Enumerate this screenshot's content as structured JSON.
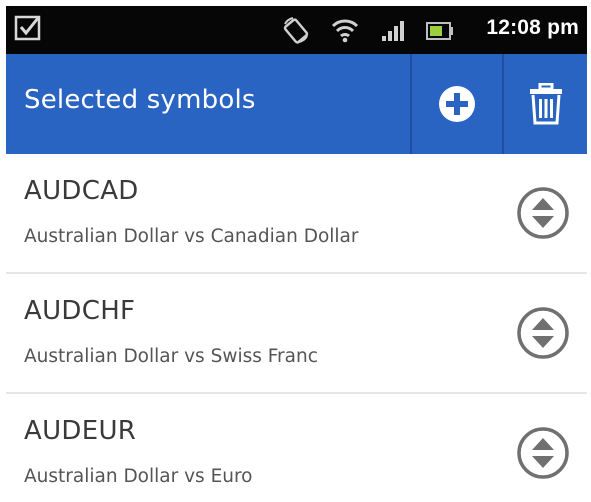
{
  "status_bar": {
    "time": "12:08 pm",
    "icons": [
      "notification-check-icon",
      "rotate-lock-icon",
      "wifi-icon",
      "signal-icon",
      "battery-icon"
    ]
  },
  "action_bar": {
    "title": "Selected symbols",
    "actions": [
      "add-icon",
      "trash-icon"
    ],
    "color": "#2a64c2"
  },
  "symbols": [
    {
      "code": "AUDCAD",
      "description": "Australian Dollar vs Canadian Dollar"
    },
    {
      "code": "AUDCHF",
      "description": "Australian Dollar vs Swiss Franc"
    },
    {
      "code": "AUDEUR",
      "description": "Australian Dollar vs Euro"
    }
  ]
}
